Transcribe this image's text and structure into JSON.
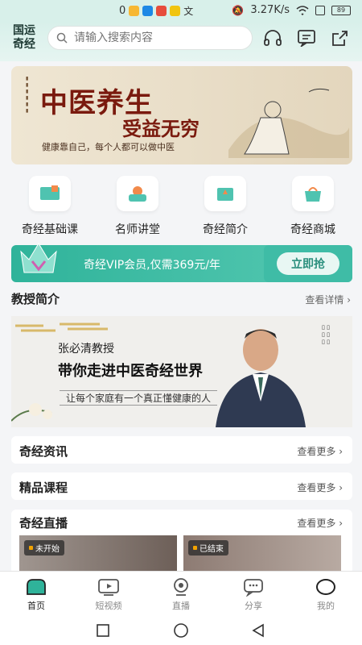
{
  "status_bar": {
    "notif_count": "0",
    "net_speed": "3.27K/s",
    "battery": "89"
  },
  "header": {
    "brand": "国运奇经",
    "search_placeholder": "请输入搜索内容"
  },
  "banner": {
    "title1": "中医养生",
    "title2": "受益无穷",
    "subtitle": "健康靠自己，每个人都可以做中医"
  },
  "categories": [
    {
      "label": "奇经基础课",
      "icon": "course-icon"
    },
    {
      "label": "名师讲堂",
      "icon": "lecture-icon"
    },
    {
      "label": "奇经简介",
      "icon": "intro-icon"
    },
    {
      "label": "奇经商城",
      "icon": "shop-icon"
    }
  ],
  "vip": {
    "text": "奇经VIP会员,仅需369元/年",
    "button": "立即抢"
  },
  "professor": {
    "section_title": "教授简介",
    "more": "查看详情",
    "name": "张必清教授",
    "slogan": "带你走进中医奇经世界",
    "line": "让每个家庭有一个真正懂健康的人"
  },
  "news": {
    "title": "奇经资讯",
    "more": "查看更多"
  },
  "courses": {
    "title": "精品课程",
    "more": "查看更多"
  },
  "live": {
    "title": "奇经直播",
    "more": "查看更多",
    "items": [
      {
        "tag": "未开始"
      },
      {
        "tag": "已结束"
      }
    ]
  },
  "bottom_nav": [
    {
      "label": "首页",
      "icon": "home-icon",
      "active": true
    },
    {
      "label": "短视频",
      "icon": "video-icon",
      "active": false
    },
    {
      "label": "直播",
      "icon": "live-icon",
      "active": false
    },
    {
      "label": "分享",
      "icon": "share-chat-icon",
      "active": false
    },
    {
      "label": "我的",
      "icon": "profile-icon",
      "active": false
    }
  ],
  "colors": {
    "accent": "#2fb39a",
    "header_bg": "#d8f0ea",
    "banner_text": "#7a1a0e"
  }
}
